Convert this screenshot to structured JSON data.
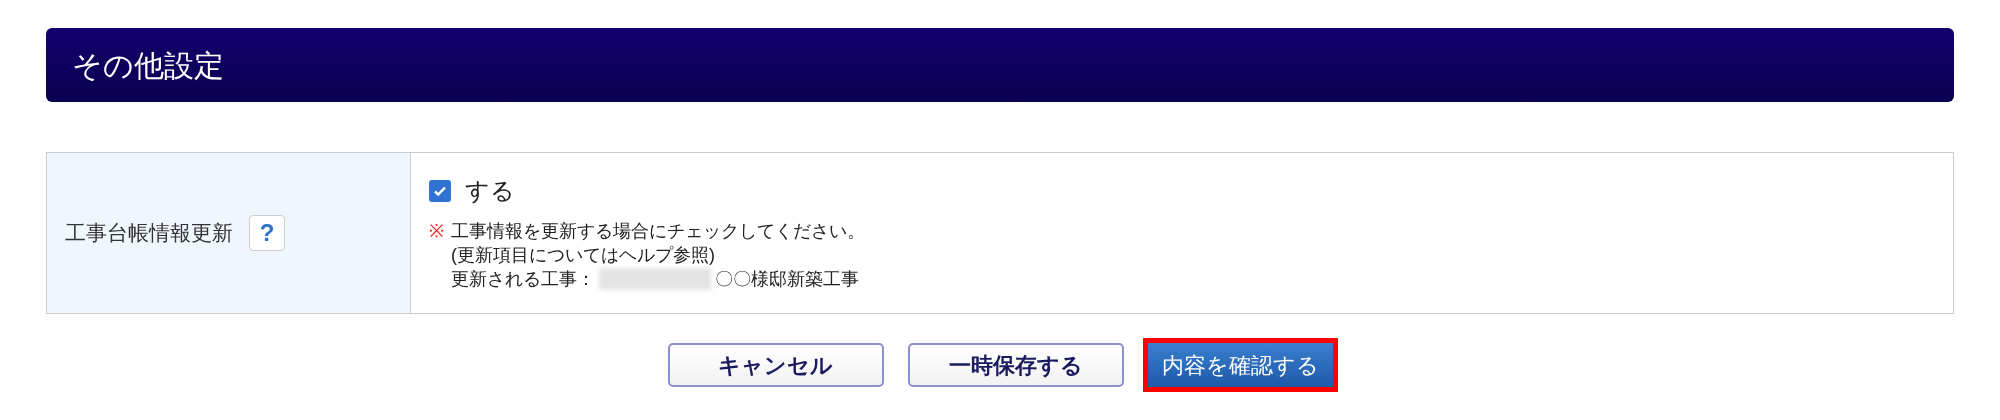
{
  "section": {
    "title": "その他設定"
  },
  "setting": {
    "label": "工事台帳情報更新",
    "help": "?",
    "checkbox": {
      "label": "する",
      "checked": true
    },
    "note_mark": "※",
    "note_lines": [
      "工事情報を更新する場合にチェックしてください。",
      "(更新項目についてはヘルプ参照)"
    ],
    "target_label": "更新される工事：",
    "target_name": "〇〇様邸新築工事"
  },
  "buttons": [
    {
      "label": "キャンセル",
      "kind": "secondary",
      "highlighted": false
    },
    {
      "label": "一時保存する",
      "kind": "secondary",
      "highlighted": false
    },
    {
      "label": "内容を確認する",
      "kind": "primary",
      "highlighted": true
    }
  ]
}
